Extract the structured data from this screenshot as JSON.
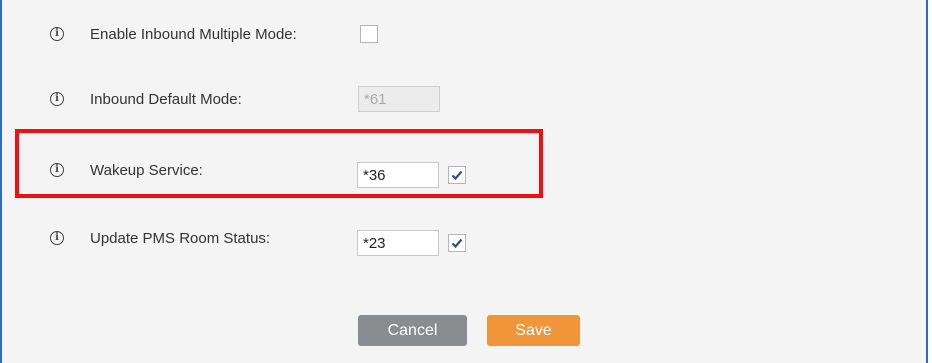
{
  "fields": {
    "inbound_multiple": {
      "label": "Enable Inbound Multiple Mode:",
      "checked": false
    },
    "inbound_default": {
      "label": "Inbound Default Mode:",
      "value": "*61",
      "disabled": true
    },
    "wakeup_service": {
      "label": "Wakeup Service:",
      "value": "*36",
      "checked": true
    },
    "pms_room_status": {
      "label": "Update PMS Room Status:",
      "value": "*23",
      "checked": true
    }
  },
  "buttons": {
    "cancel": "Cancel",
    "save": "Save"
  },
  "icons": {
    "info": "info-icon",
    "check": "checkmark-icon"
  },
  "colors": {
    "panel_border": "#2d6cc0",
    "highlight": "#ee1111",
    "cancel_button": "#8a8c8f",
    "save_button": "#f0953a",
    "checkmark": "#2b4f8f"
  }
}
